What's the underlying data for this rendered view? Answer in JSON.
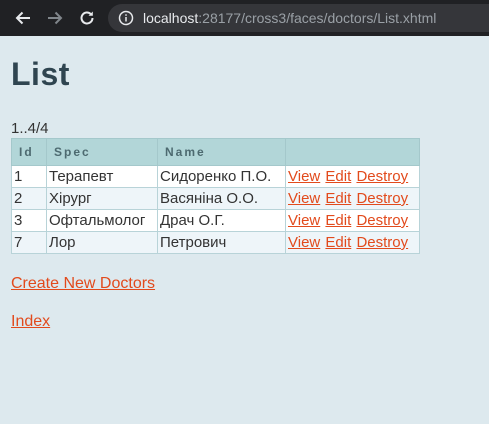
{
  "browser": {
    "url_host": "localhost",
    "url_rest": ":28177/cross3/faces/doctors/List.xhtml"
  },
  "page": {
    "title": "List",
    "pagination": "1..4/4",
    "columns": {
      "id": "Id",
      "spec": "Spec",
      "name": "Name",
      "actions": ""
    },
    "rows": [
      {
        "id": "1",
        "spec": "Терапевт",
        "name": "Сидоренко П.О."
      },
      {
        "id": "2",
        "spec": "Хірург",
        "name": "Васяніна О.О."
      },
      {
        "id": "3",
        "spec": "Офтальмолог",
        "name": "Драч О.Г."
      },
      {
        "id": "7",
        "spec": "Лор",
        "name": "Петрович"
      }
    ],
    "row_actions": {
      "view": "View",
      "edit": "Edit",
      "destroy": "Destroy"
    },
    "create_link": "Create New Doctors",
    "index_link": "Index"
  },
  "colors": {
    "background": "#dde9ee",
    "header_bg": "#b2d6d8",
    "link": "#e24a1c"
  }
}
